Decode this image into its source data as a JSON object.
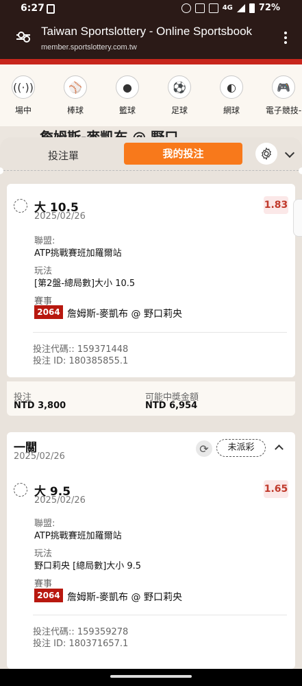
{
  "status_bar": {
    "time": "6:27",
    "network": "4G",
    "battery": "72%"
  },
  "browser": {
    "title": "Taiwan Sportslottery - Online Sportsbook",
    "url": "member.sportslottery.com.tw"
  },
  "categories": [
    {
      "label": "場中",
      "icon": "live-icon"
    },
    {
      "label": "棒球",
      "icon": "baseball-icon"
    },
    {
      "label": "籃球",
      "icon": "basketball-icon"
    },
    {
      "label": "足球",
      "icon": "soccer-icon"
    },
    {
      "label": "網球",
      "icon": "tennis-icon"
    },
    {
      "label": "電子競技-",
      "icon": "esports-icon"
    }
  ],
  "match_title": "詹姆斯-麥凱布 @ 野口",
  "tabs": {
    "betslip": "投注單",
    "my_bets": "我的投注"
  },
  "bet1": {
    "selection": "大 10.5",
    "date": "2025/02/26",
    "odds": "1.83",
    "league_label": "聯盟:",
    "league": "ATP挑戰賽班加羅爾站",
    "market_label": "玩法",
    "market": "[第2盤-總局數]大小 10.5",
    "event_label": "賽事",
    "event_code": "2064",
    "event_name": "詹姆斯-麥凱布 @ 野口莉央",
    "bet_code": "投注代碼:: 159371448",
    "bet_id": "投注 ID: 180385855.1",
    "stake_label": "投注",
    "stake": "NTD 3,800",
    "payout_label": "可能中獎金額",
    "payout": "NTD 6,954"
  },
  "bet2": {
    "title": "一關",
    "date": "2025/02/26",
    "status": "未派彩",
    "selection": "大 9.5",
    "sel_date": "2025/02/26",
    "odds": "1.65",
    "league_label": "聯盟:",
    "league": "ATP挑戰賽班加羅爾站",
    "market_label": "玩法",
    "market": "野口莉央 [總局數]大小 9.5",
    "event_label": "賽事",
    "event_code": "2064",
    "event_name": "詹姆斯-麥凱布 @ 野口莉央",
    "bet_code": "投注代碼:: 159359278",
    "bet_id": "投注 ID: 180371657.1"
  },
  "colors": {
    "accent": "#f8791b",
    "brand_red": "#c8261c",
    "header_dark": "#2b1a17",
    "odds_text": "#c0392b"
  }
}
